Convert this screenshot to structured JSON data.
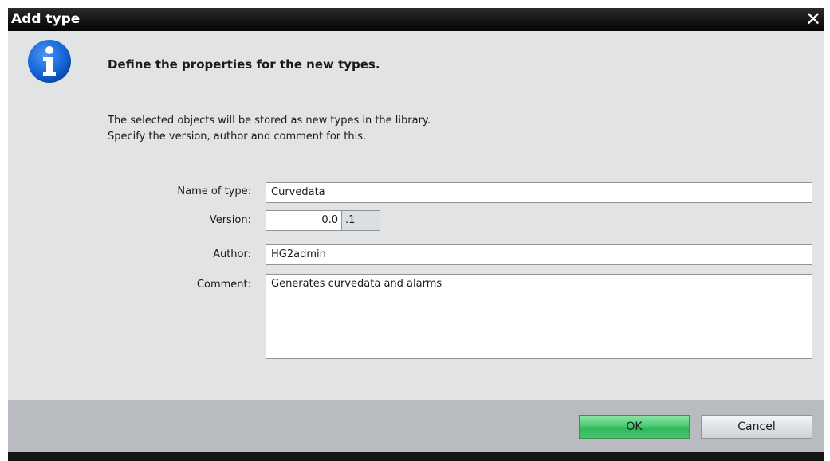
{
  "window": {
    "title": "Add type",
    "close_glyph": "✕"
  },
  "dialog": {
    "icon": "info-icon",
    "heading": "Define the properties for the new types.",
    "description_line1": "The selected objects will be stored as new types in the library.",
    "description_line2": "Specify the version, author and comment for this."
  },
  "form": {
    "name_label": "Name of type:",
    "name_value": "Curvedata",
    "version_label": "Version:",
    "version_major": "0.0",
    "version_minor": ".1",
    "author_label": "Author:",
    "author_value": "HG2admin",
    "comment_label": "Comment:",
    "comment_value": "Generates curvedata and alarms"
  },
  "buttons": {
    "ok_label": "OK",
    "cancel_label": "Cancel"
  },
  "colors": {
    "accent_ok": "#4ccd73",
    "info_blue": "#1565d8",
    "titlebar": "#141414"
  }
}
